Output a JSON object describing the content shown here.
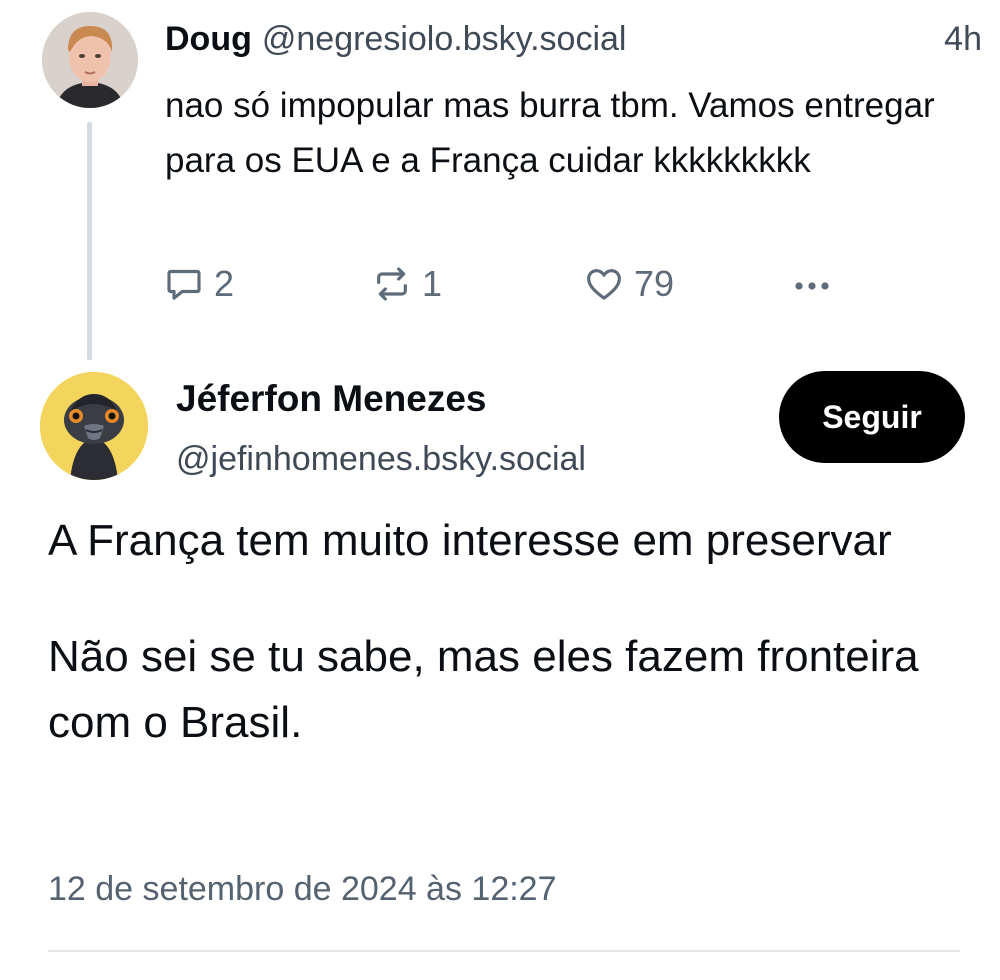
{
  "parent_post": {
    "author_name": "Doug",
    "author_handle": "@negresiolo.bsky.social",
    "time": "4h",
    "text": "nao só impopular mas burra tbm. Vamos entregar para os EUA e a França cuidar kkkkkkkkk",
    "counts": {
      "replies": "2",
      "reposts": "1",
      "likes": "79"
    },
    "icons": [
      "reply-icon",
      "repost-icon",
      "like-icon",
      "more-icon"
    ]
  },
  "main_post": {
    "author_name": "Jéferfon Menezes",
    "author_handle": "@jefinhomenes.bsky.social",
    "follow_label": "Seguir",
    "text_p1": "A França tem muito interesse em preservar",
    "text_p2": "Não sei se tu sabe, mas eles fazem fronteira com o Brasil.",
    "date": "12 de setembro de 2024 às 12:27"
  },
  "colors": {
    "text": "#0b0f14",
    "muted": "#3f4a56",
    "icon": "#5e6b78",
    "thread_line": "#d4dbe2",
    "follow_bg": "#000000"
  }
}
